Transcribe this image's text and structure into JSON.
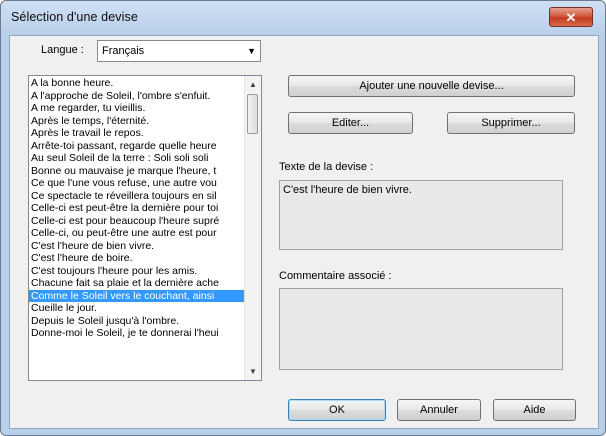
{
  "window": {
    "title": "Sélection d'une devise",
    "close_glyph": "✕"
  },
  "language": {
    "label": "Langue :",
    "selected": "Français"
  },
  "mottos": {
    "selected_index": 17,
    "items": [
      "A la bonne heure.",
      "A l'approche de Soleil, l'ombre s'enfuit.",
      "A me regarder, tu vieillis.",
      "Après le temps, l'éternité.",
      "Après le travail le repos.",
      "Arrête-toi passant, regarde quelle heure",
      "Au seul Soleil de la terre : Soli soli soli",
      "Bonne ou mauvaise je marque l'heure, t",
      "Ce que l'une vous refuse, une autre vou",
      "Ce spectacle te réveillera toujours en sil",
      "Celle-ci est peut-être la dernière pour toi",
      "Celle-ci est pour beaucoup l'heure supré",
      "Celle-ci, ou peut-être une autre est pour",
      "C'est l'heure de bien vivre.",
      "C'est l'heure de boire.",
      "C'est toujours l'heure pour les amis.",
      "Chacune fait sa plaie et la dernière ache",
      "Comme le Soleil vers le couchant, ainsi",
      "Cueille le jour.",
      "Depuis le Soleil jusqu'à l'ombre.",
      "Donne-moi le Soleil, je te donnerai l'heui"
    ]
  },
  "buttons": {
    "add": "Ajouter une nouvelle devise...",
    "edit": "Editer...",
    "delete": "Supprimer...",
    "ok": "OK",
    "cancel": "Annuler",
    "help": "Aide"
  },
  "motto_text": {
    "label": "Texte de la devise :",
    "value": "C'est l'heure de bien vivre."
  },
  "comment": {
    "label": "Commentaire associé :",
    "value": ""
  }
}
